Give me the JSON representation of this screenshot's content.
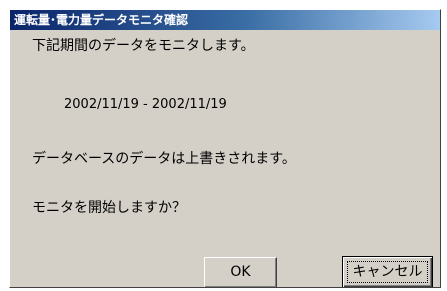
{
  "dialog": {
    "title": "運転量･電力量データモニタ確認",
    "line1": "下記期間のデータをモニタします。",
    "date_range": "2002/11/19 - 2002/11/19",
    "line2": "データベースのデータは上書きされます。",
    "line3": "モニタを開始しますか？"
  },
  "buttons": {
    "ok_label": "OK",
    "cancel_label": "キャンセル"
  },
  "colors": {
    "face": "#d4d0c8",
    "title_start": "#0a246a",
    "title_end": "#a6caf0"
  }
}
